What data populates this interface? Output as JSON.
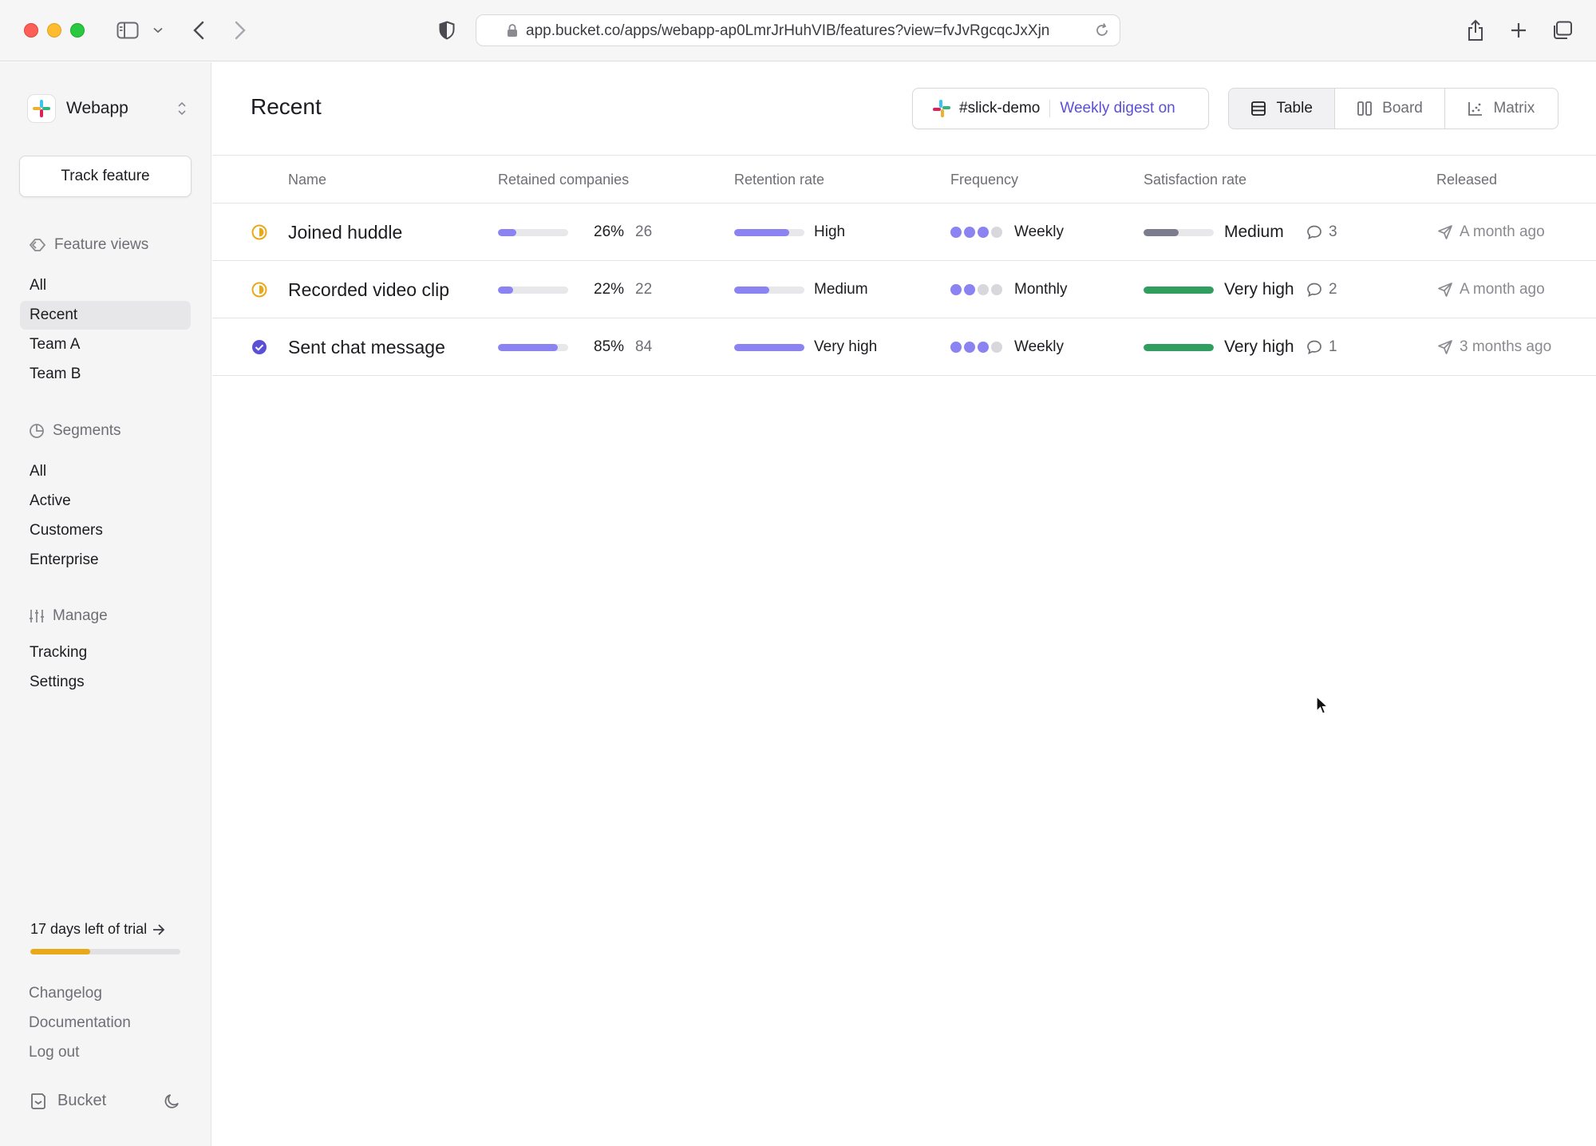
{
  "browser": {
    "url": "app.bucket.co/apps/webapp-ap0LmrJrHuhVIB/features?view=fvJvRgcqcJxXjn"
  },
  "sidebar": {
    "app_name": "Webapp",
    "track_button": "Track feature",
    "feature_views": {
      "heading": "Feature views",
      "items": [
        {
          "label": "All"
        },
        {
          "label": "Recent",
          "active": true
        },
        {
          "label": "Team A"
        },
        {
          "label": "Team B"
        }
      ]
    },
    "segments": {
      "heading": "Segments",
      "items": [
        {
          "label": "All"
        },
        {
          "label": "Active"
        },
        {
          "label": "Customers"
        },
        {
          "label": "Enterprise"
        }
      ]
    },
    "manage": {
      "heading": "Manage",
      "items": [
        {
          "label": "Tracking"
        },
        {
          "label": "Settings"
        }
      ]
    },
    "trial": {
      "text": "17 days left of trial",
      "progress": 0.4
    },
    "footer_links": [
      "Changelog",
      "Documentation",
      "Log out"
    ],
    "brand": "Bucket"
  },
  "main": {
    "title": "Recent",
    "slack": {
      "channel": "#slick-demo",
      "digest": "Weekly digest on"
    },
    "views": [
      {
        "label": "Table",
        "icon": "table-icon",
        "active": true
      },
      {
        "label": "Board",
        "icon": "board-icon"
      },
      {
        "label": "Matrix",
        "icon": "matrix-icon"
      }
    ],
    "columns": [
      "Name",
      "Retained companies",
      "Retention rate",
      "Frequency",
      "Satisfaction rate",
      "Released"
    ],
    "rows": [
      {
        "status": "in-progress",
        "name": "Joined huddle",
        "retained_pct": "26%",
        "retained_fraction": 0.26,
        "retained_count": "26",
        "retention_label": "High",
        "retention_fraction": 0.78,
        "frequency_level": 3,
        "frequency_label": "Weekly",
        "satisfaction_label": "Medium",
        "satisfaction_fraction": 0.5,
        "satisfaction_color": "#7b7d8c",
        "comments": "3",
        "released": "A month ago"
      },
      {
        "status": "in-progress",
        "name": "Recorded video clip",
        "retained_pct": "22%",
        "retained_fraction": 0.22,
        "retained_count": "22",
        "retention_label": "Medium",
        "retention_fraction": 0.5,
        "frequency_level": 2,
        "frequency_label": "Monthly",
        "satisfaction_label": "Very high",
        "satisfaction_fraction": 1.0,
        "satisfaction_color": "#2f9e5f",
        "comments": "2",
        "released": "A month ago"
      },
      {
        "status": "completed",
        "name": "Sent chat message",
        "retained_pct": "85%",
        "retained_fraction": 0.85,
        "retained_count": "84",
        "retention_label": "Very high",
        "retention_fraction": 1.0,
        "frequency_level": 3,
        "frequency_label": "Weekly",
        "satisfaction_label": "Very high",
        "satisfaction_fraction": 1.0,
        "satisfaction_color": "#2f9e5f",
        "comments": "1",
        "released": "3 months ago"
      }
    ]
  },
  "colors": {
    "accent": "#5b4fd6",
    "bar_purple": "#8b83f2",
    "status_yellow": "#e8a817",
    "status_done": "#5b4fd6",
    "dot_empty": "#d8d8dc"
  }
}
